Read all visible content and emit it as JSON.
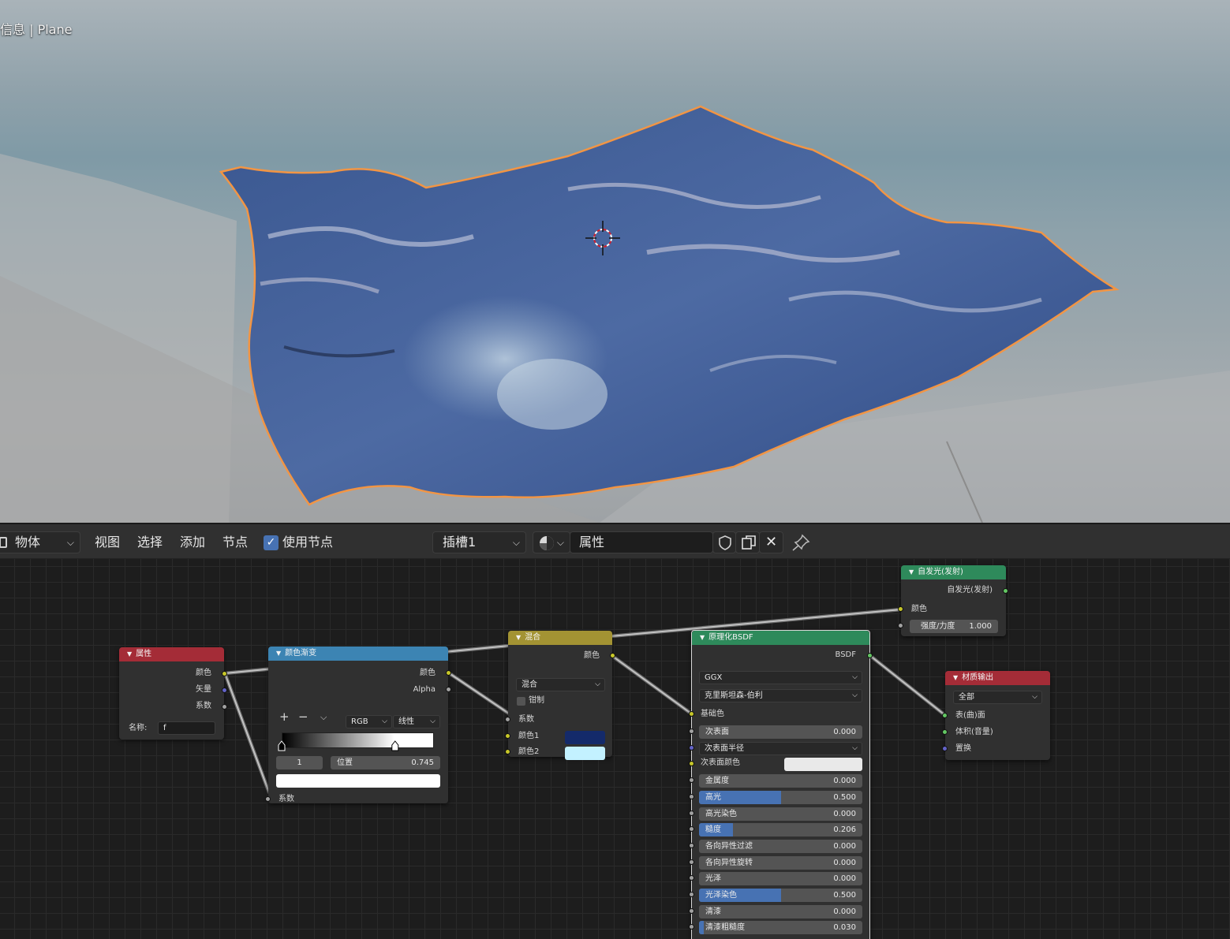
{
  "viewport": {
    "title": "信息 | Plane"
  },
  "header": {
    "mode": "物体",
    "menus": [
      "视图",
      "选择",
      "添加",
      "节点"
    ],
    "use_nodes_label": "使用节点",
    "use_nodes_checked": true,
    "slot": "插槽1",
    "material_name": "属性"
  },
  "nodes": {
    "attribute": {
      "title": "属性",
      "outputs": [
        "颜色",
        "矢量",
        "系数"
      ],
      "name_label": "名称:",
      "name_value": "f",
      "color": "#a42c37"
    },
    "colorramp": {
      "title": "颜色渐变",
      "outputs": [
        "颜色",
        "Alpha"
      ],
      "add": "+",
      "remove": "−",
      "menu": "⌵",
      "color_mode": "RGB",
      "interpolation": "线性",
      "index": "1",
      "pos_label": "位置",
      "pos_value": "0.745",
      "input": "系数",
      "stop_positions": [
        0,
        0.745
      ],
      "color": "#3c84b3"
    },
    "mix": {
      "title": "混合",
      "output": "颜色",
      "blend": "混合",
      "clamp": "钳制",
      "inputs": [
        "系数",
        "颜色1",
        "颜色2"
      ],
      "color1": "#142a6a",
      "color2": "#c3f1ff",
      "color": "#a39333"
    },
    "emission": {
      "title": "自发光(发射)",
      "output": "自发光(发射)",
      "color_in": "颜色",
      "strength_label": "强度/力度",
      "strength": "1.000",
      "color": "#2e8a5b"
    },
    "bsdf": {
      "title": "原理化BSDF",
      "output": "BSDF",
      "distribution": "GGX",
      "subsurface_method": "克里斯坦森-伯利",
      "base_color": "基础色",
      "color": "#2e8a5b",
      "params": [
        {
          "label": "次表面",
          "value": "0.000",
          "fill": 0,
          "socket": "gs"
        },
        {
          "label": "次表面半径",
          "value": "",
          "fill": 0,
          "socket": "ps",
          "dropdown": true
        },
        {
          "label": "次表面颜色",
          "value": "",
          "fill": 0,
          "socket": "ys",
          "swatch": "#e9e9e9"
        },
        {
          "label": "金属度",
          "value": "0.000",
          "fill": 0,
          "socket": "gs"
        },
        {
          "label": "高光",
          "value": "0.500",
          "fill": 0.5,
          "socket": "gs"
        },
        {
          "label": "高光染色",
          "value": "0.000",
          "fill": 0,
          "socket": "gs"
        },
        {
          "label": "糙度",
          "value": "0.206",
          "fill": 0.206,
          "socket": "gs"
        },
        {
          "label": "各向异性过滤",
          "value": "0.000",
          "fill": 0,
          "socket": "gs"
        },
        {
          "label": "各向异性旋转",
          "value": "0.000",
          "fill": 0,
          "socket": "gs"
        },
        {
          "label": "光泽",
          "value": "0.000",
          "fill": 0,
          "socket": "gs"
        },
        {
          "label": "光泽染色",
          "value": "0.500",
          "fill": 0.5,
          "socket": "gs"
        },
        {
          "label": "清漆",
          "value": "0.000",
          "fill": 0,
          "socket": "gs"
        },
        {
          "label": "清漆粗糙度",
          "value": "0.030",
          "fill": 0.03,
          "socket": "gs"
        }
      ]
    },
    "output": {
      "title": "材质输出",
      "target": "全部",
      "inputs": [
        "表(曲)面",
        "体积(音量)",
        "置换"
      ],
      "color": "#a42c37"
    }
  }
}
